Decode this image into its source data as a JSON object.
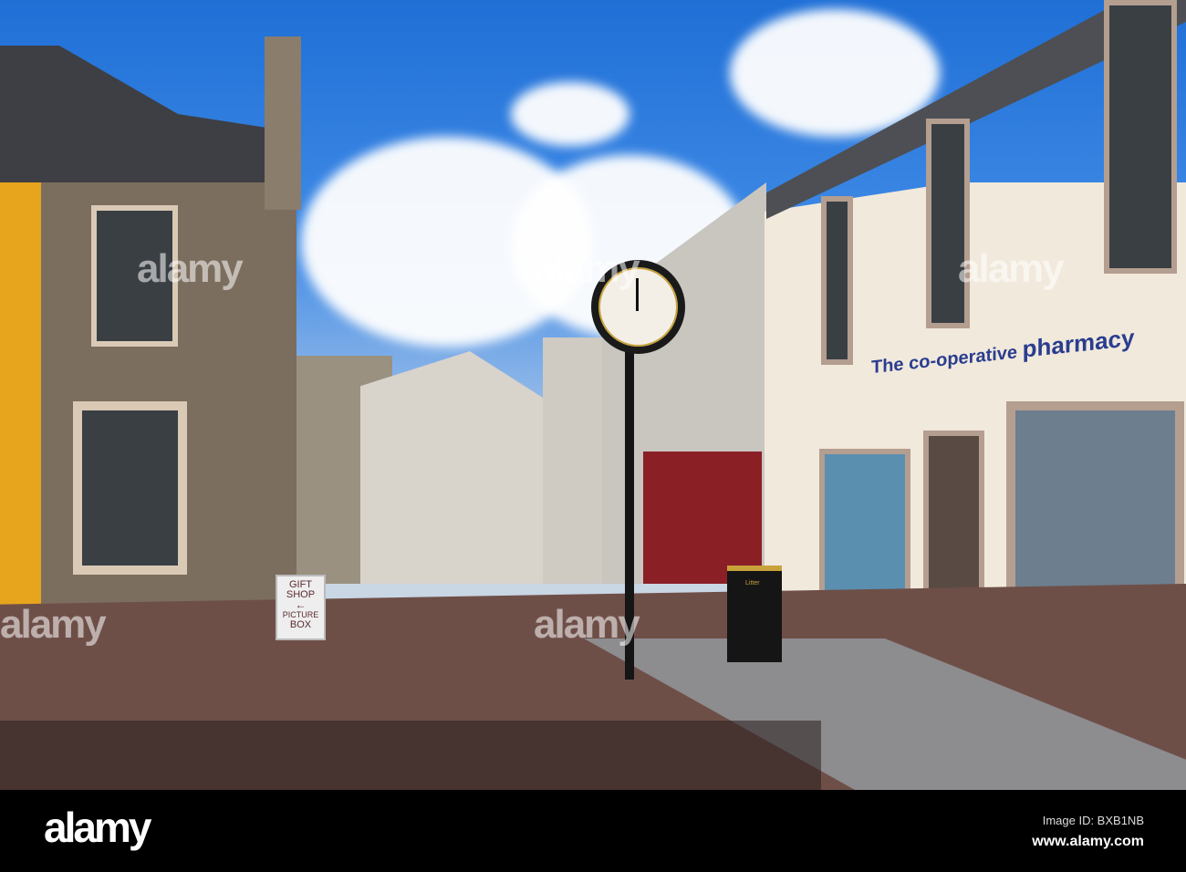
{
  "sign": {
    "line1": "GIFT",
    "line2": "SHOP",
    "line3": "PICTURE",
    "line4": "BOX"
  },
  "shop_sign": {
    "brand": "The co-operative",
    "word": "pharmacy"
  },
  "bin_label": "Litter",
  "watermark": "alamy",
  "footer": {
    "logo": "alamy",
    "image_id": "Image ID: BXB1NB",
    "url": "www.alamy.com"
  },
  "colors": {
    "sky": "#2a78dc",
    "cream": "#f1e9dc",
    "road": "#6e4f48",
    "stone": "#7c6e5e"
  }
}
